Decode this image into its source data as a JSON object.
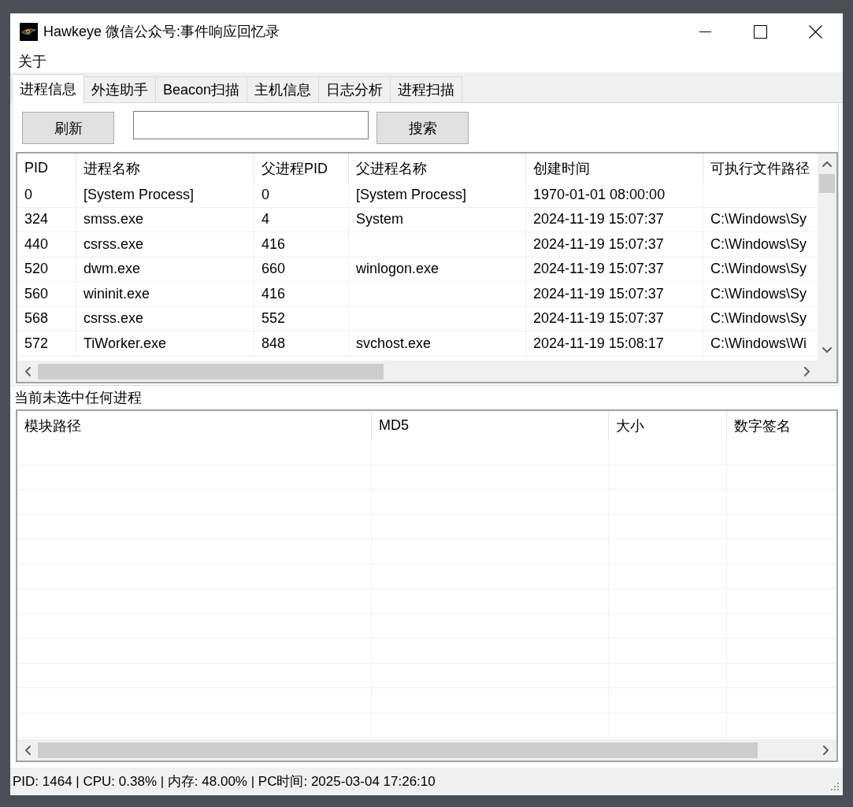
{
  "window": {
    "title": "Hawkeye 微信公众号:事件响应回忆录"
  },
  "menu": [
    {
      "label": "关于"
    }
  ],
  "tabs": [
    {
      "label": "进程信息",
      "selected": true
    },
    {
      "label": "外连助手",
      "selected": false
    },
    {
      "label": "Beacon扫描",
      "selected": false
    },
    {
      "label": "主机信息",
      "selected": false
    },
    {
      "label": "日志分析",
      "selected": false
    },
    {
      "label": "进程扫描",
      "selected": false
    }
  ],
  "toolbar": {
    "refresh_button": "刷新",
    "search_button": "搜索"
  },
  "process_table": {
    "columns": [
      "PID",
      "进程名称",
      "父进程PID",
      "父进程名称",
      "创建时间",
      "可执行文件路径"
    ],
    "rows": [
      {
        "pid": "0",
        "name": "[System Process]",
        "parent_pid": "0",
        "parent_name": "[System Process]",
        "created": "1970-01-01 08:00:00"
      },
      {
        "pid": "324",
        "name": "smss.exe",
        "parent_pid": "4",
        "parent_name": "System",
        "created": "2024-11-19 15:07:37",
        "path": "C:\\Windows\\Sy"
      },
      {
        "pid": "440",
        "name": "csrss.exe",
        "parent_pid": "416",
        "created": "2024-11-19 15:07:37",
        "path": "C:\\Windows\\Sy"
      },
      {
        "pid": "520",
        "name": "dwm.exe",
        "parent_pid": "660",
        "parent_name": "winlogon.exe",
        "created": "2024-11-19 15:07:37",
        "path": "C:\\Windows\\Sy"
      },
      {
        "pid": "560",
        "name": "wininit.exe",
        "parent_pid": "416",
        "created": "2024-11-19 15:07:37",
        "path": "C:\\Windows\\Sy"
      },
      {
        "pid": "568",
        "name": "csrss.exe",
        "parent_pid": "552",
        "created": "2024-11-19 15:07:37",
        "path": "C:\\Windows\\Sy"
      },
      {
        "pid": "572",
        "name": "TiWorker.exe",
        "parent_pid": "848",
        "parent_name": "svchost.exe",
        "created": "2024-11-19 15:08:17",
        "path": "C:\\Windows\\Wi"
      }
    ]
  },
  "module_panel": {
    "status_label": "当前未选中任何进程",
    "columns": [
      "模块路径",
      "MD5",
      "大小",
      "数字签名"
    ]
  },
  "status_bar": {
    "text": "PID: 1464 | CPU: 0.38% | 内存: 48.00% | PC时间: 2025-03-04 17:26:10"
  }
}
